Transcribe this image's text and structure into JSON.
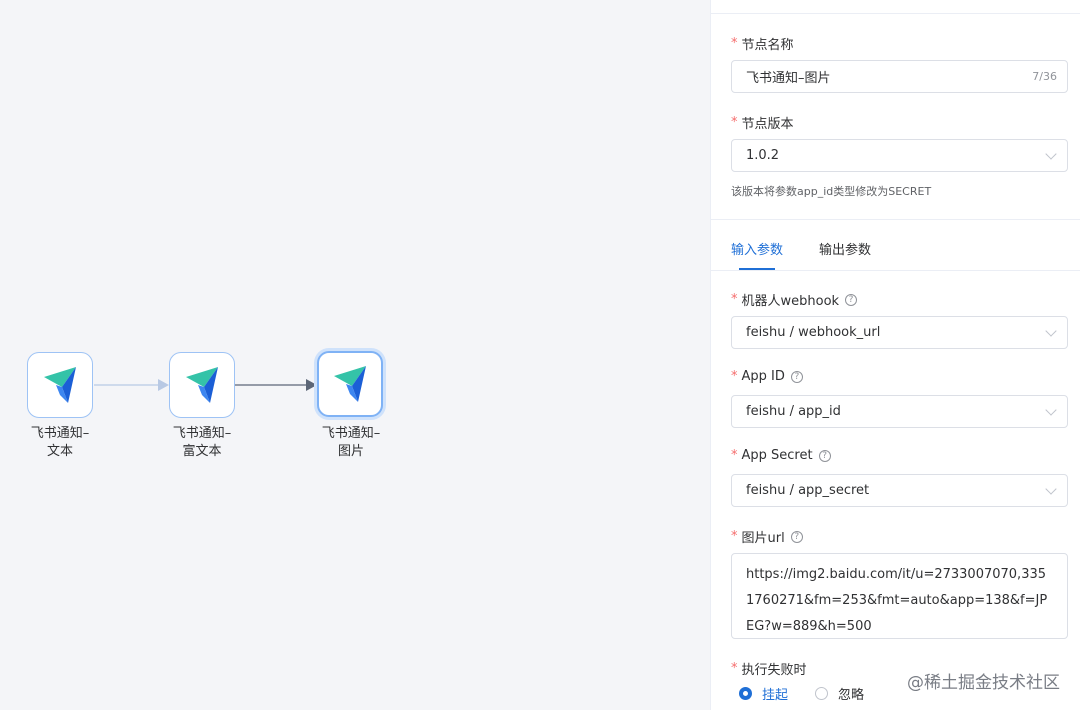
{
  "canvas": {
    "nodes": [
      {
        "label_line1": "飞书通知–",
        "label_line2": "文本",
        "icon": "feishu-paper-plane-icon"
      },
      {
        "label_line1": "飞书通知–",
        "label_line2": "富文本",
        "icon": "feishu-paper-plane-icon"
      },
      {
        "label_line1": "飞书通知–",
        "label_line2": "图片",
        "icon": "feishu-paper-plane-icon"
      }
    ]
  },
  "panel": {
    "node_name": {
      "label": "节点名称",
      "value": "飞书通知–图片",
      "count": "7/36"
    },
    "node_version": {
      "label": "节点版本",
      "value": "1.0.2",
      "hint": "该版本将参数app_id类型修改为SECRET"
    },
    "tabs": [
      {
        "label": "输入参数"
      },
      {
        "label": "输出参数"
      }
    ],
    "webhook": {
      "label": "机器人webhook",
      "value": "feishu / webhook_url"
    },
    "app_id": {
      "label": "App ID",
      "value": "feishu / app_id"
    },
    "app_secret": {
      "label": "App Secret",
      "value": "feishu / app_secret"
    },
    "image_url": {
      "label": "图片url",
      "value": "https://img2.baidu.com/it/u=2733007070,3351760271&fm=253&fmt=auto&app=138&f=JPEG?w=889&h=500"
    },
    "on_failure": {
      "label": "执行失败时",
      "options": [
        {
          "label": "挂起"
        },
        {
          "label": "忽略"
        }
      ]
    },
    "required_mark": "*",
    "help_glyph": "?"
  },
  "watermark": "@稀土掘金技术社区",
  "colors": {
    "accent": "#1f6fd6",
    "required": "#f56c6c",
    "canvas_bg": "#f4f5f8"
  }
}
